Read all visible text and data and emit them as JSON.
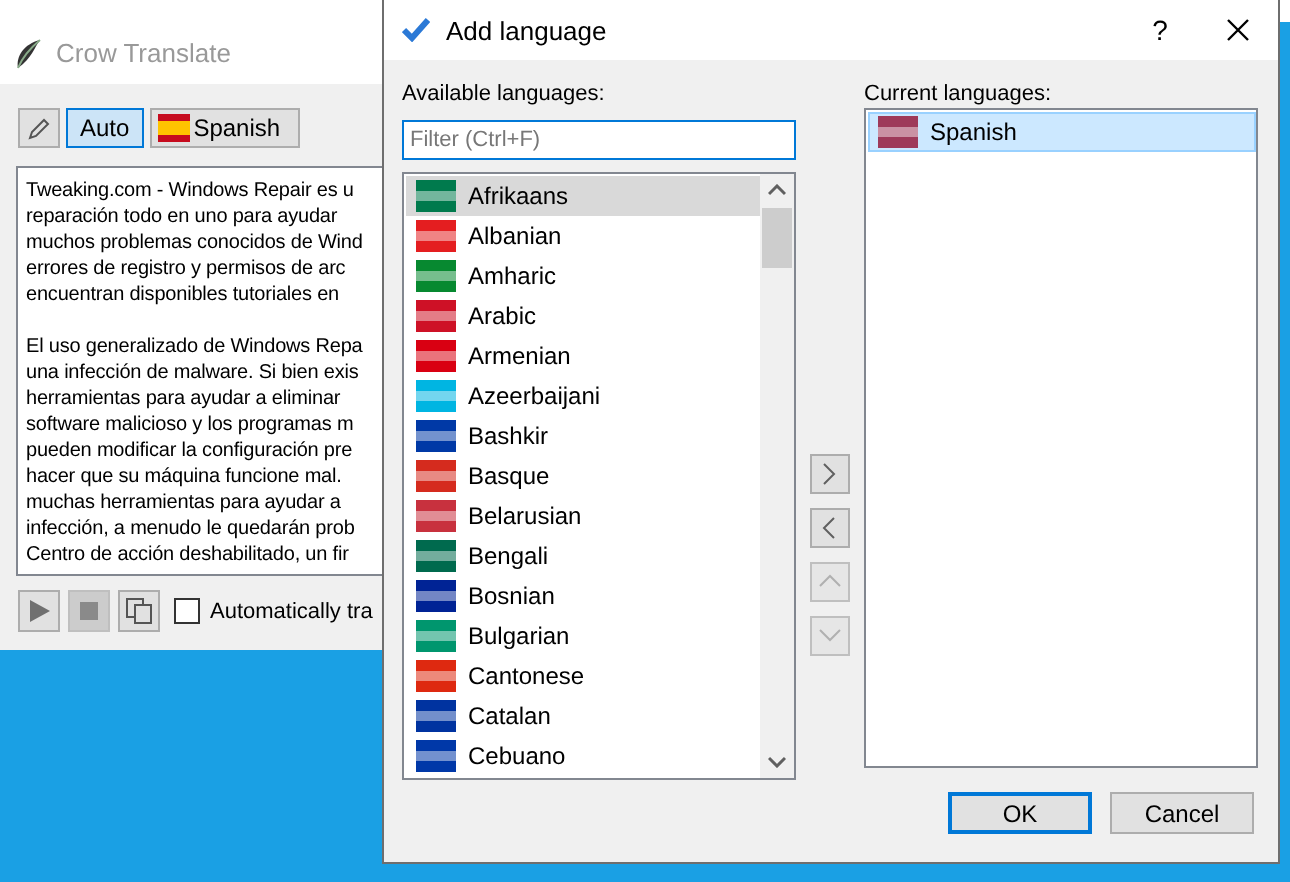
{
  "main_window": {
    "title": "Crow Translate",
    "toolbar": [
      {
        "kind": "edit",
        "selected": false
      },
      {
        "kind": "text",
        "label": "Auto",
        "selected": true
      },
      {
        "kind": "language",
        "label": "Spanish",
        "selected": false,
        "color": "#c60b1e"
      }
    ],
    "paragraphs": [
      [
        "Tweaking.com - Windows Repair es u",
        "reparación todo en uno para ayudar",
        "muchos problemas conocidos de Wind",
        "errores de registro y permisos de arc",
        "encuentran disponibles tutoriales en"
      ],
      [
        "El uso generalizado de Windows Repa",
        "una infección de malware. Si bien exis",
        "herramientas para ayudar a eliminar",
        "software malicioso y los programas m",
        "pueden modificar la configuración pre",
        "hacer que su máquina funcione mal.",
        "muchas herramientas para ayudar a",
        "infección, a menudo le quedarán prob",
        "Centro de acción deshabilitado, un fir"
      ]
    ],
    "controls": [
      {
        "kind": "play",
        "disabled": false
      },
      {
        "kind": "stop",
        "disabled": true
      },
      {
        "kind": "copy",
        "disabled": false
      }
    ],
    "auto_checkbox": {
      "label": "Automatically tra",
      "checked": false
    }
  },
  "dialog": {
    "title": "Add language",
    "help": "?",
    "available_label": "Available languages:",
    "filter": {
      "placeholder": "Filter (Ctrl+F)"
    },
    "available": [
      {
        "name": "Afrikaans",
        "selected": true,
        "color": "#007a4d"
      },
      {
        "name": "Albanian",
        "selected": false,
        "color": "#e41e20"
      },
      {
        "name": "Amharic",
        "selected": false,
        "color": "#078930"
      },
      {
        "name": "Arabic",
        "selected": false,
        "color": "#ce1126"
      },
      {
        "name": "Armenian",
        "selected": false,
        "color": "#d90012"
      },
      {
        "name": "Azeerbaijani",
        "selected": false,
        "color": "#00b5e2"
      },
      {
        "name": "Bashkir",
        "selected": false,
        "color": "#0039a6"
      },
      {
        "name": "Basque",
        "selected": false,
        "color": "#d52b1e"
      },
      {
        "name": "Belarusian",
        "selected": false,
        "color": "#c8313e"
      },
      {
        "name": "Bengali",
        "selected": false,
        "color": "#006a4e"
      },
      {
        "name": "Bosnian",
        "selected": false,
        "color": "#002395"
      },
      {
        "name": "Bulgarian",
        "selected": false,
        "color": "#00966e"
      },
      {
        "name": "Cantonese",
        "selected": false,
        "color": "#de2910"
      },
      {
        "name": "Catalan",
        "selected": false,
        "color": "#0033a0"
      },
      {
        "name": "Cebuano",
        "selected": false,
        "color": "#0038a8"
      }
    ],
    "move_buttons": [
      {
        "kind": "add",
        "disabled": false
      },
      {
        "kind": "remove",
        "disabled": false
      },
      {
        "kind": "up",
        "disabled": true
      },
      {
        "kind": "down",
        "disabled": true
      }
    ],
    "current_label": "Current languages:",
    "current": [
      {
        "name": "Spanish",
        "selected": true,
        "color": "#9e3a5a"
      }
    ],
    "buttons": [
      {
        "label": "OK",
        "default": true
      },
      {
        "label": "Cancel",
        "default": false
      }
    ]
  }
}
